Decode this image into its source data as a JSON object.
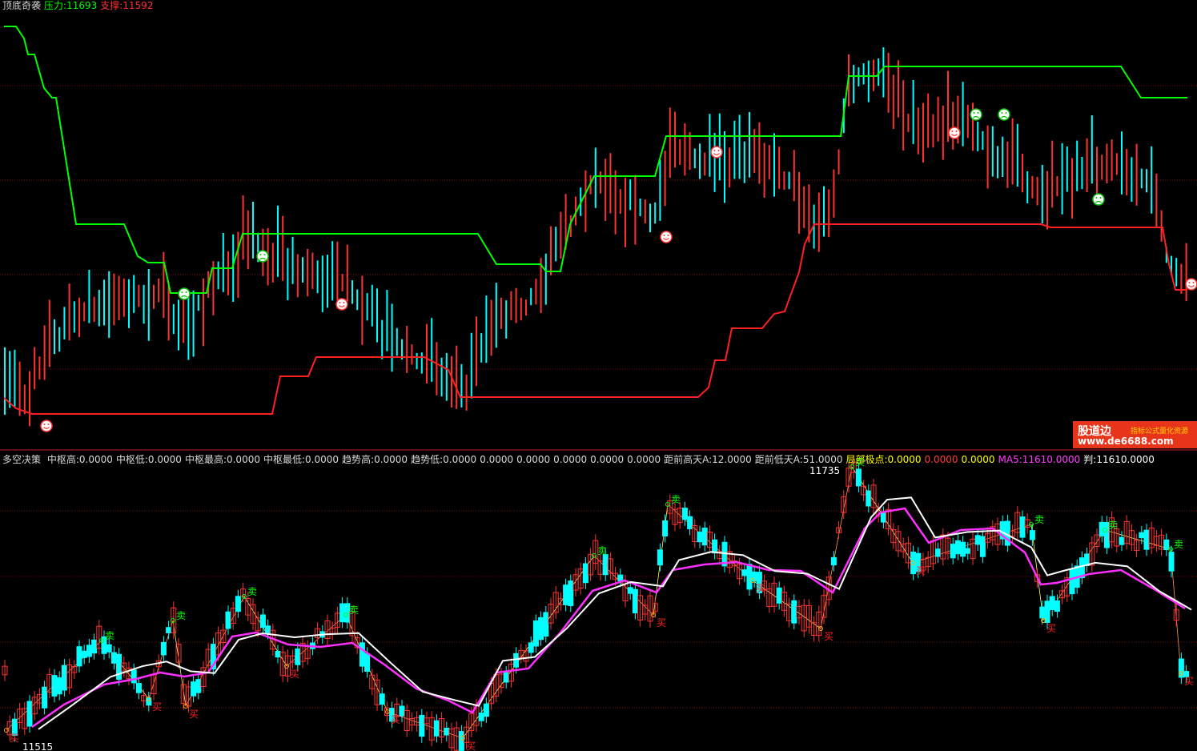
{
  "top_panel": {
    "indicator_name": "顶底奇袭",
    "pressure_label": "压力:11693",
    "support_label": "支撑:11592"
  },
  "bottom_panel": {
    "indicator_name": "多空决策",
    "fields": [
      {
        "text": "中枢高:0.0000",
        "color": "#d8d8d8"
      },
      {
        "text": "中枢低:0.0000",
        "color": "#d8d8d8"
      },
      {
        "text": "中枢最高:0.0000",
        "color": "#d8d8d8"
      },
      {
        "text": "中枢最低:0.0000",
        "color": "#d8d8d8"
      },
      {
        "text": "趋势高:0.0000",
        "color": "#d8d8d8"
      },
      {
        "text": "趋势低:0.0000",
        "color": "#d8d8d8"
      },
      {
        "text": "0.0000",
        "color": "#d8d8d8"
      },
      {
        "text": "0.0000",
        "color": "#d8d8d8"
      },
      {
        "text": "0.0000",
        "color": "#d8d8d8"
      },
      {
        "text": "0.0000",
        "color": "#d8d8d8"
      },
      {
        "text": "0.0000",
        "color": "#d8d8d8"
      },
      {
        "text": "距前高天A:12.0000",
        "color": "#d8d8d8"
      },
      {
        "text": "距前低天A:51.0000",
        "color": "#d8d8d8"
      },
      {
        "text": "局部极点:0.0000",
        "color": "#ffff00"
      },
      {
        "text": "0.0000",
        "color": "#ff3c3c"
      },
      {
        "text": "0.0000",
        "color": "#ffff00"
      },
      {
        "text": "MA5:11610.0000",
        "color": "#ff3cff"
      },
      {
        "text": "判:11610.0000",
        "color": "#ffffff"
      }
    ],
    "high_label": "11735",
    "low_label": "11515",
    "buy_marker": "买",
    "sell_marker": "卖"
  },
  "watermark": {
    "brand": "股道边",
    "tagline": "指标公式量化资源",
    "url": "www.de6688.com"
  },
  "colors": {
    "background": "#000000",
    "up_candle": "#ff3232",
    "down_candle": "#00ffff",
    "resistance_line": "#00ff00",
    "support_line": "#ff2020",
    "ma5_line": "#ff30ff",
    "judge_line": "#ffffff",
    "buy_marker": "#ff2020",
    "sell_marker": "#00ff00",
    "grid": "#7a1010",
    "separator": "#c02020"
  },
  "chart_data": [
    {
      "type": "line",
      "title": "顶底奇袭",
      "series": [
        {
          "name": "压力",
          "last_value": 11693
        },
        {
          "name": "支撑",
          "last_value": 11592
        }
      ],
      "markers": [
        "smiley-up",
        "smiley-down"
      ],
      "grid": true
    },
    {
      "type": "line",
      "title": "多空决策",
      "series": [
        {
          "name": "MA5",
          "last_value": 11610
        },
        {
          "name": "判",
          "last_value": 11610
        }
      ],
      "annotations": [
        "11735",
        "11515",
        "买",
        "卖"
      ],
      "grid": true
    }
  ]
}
